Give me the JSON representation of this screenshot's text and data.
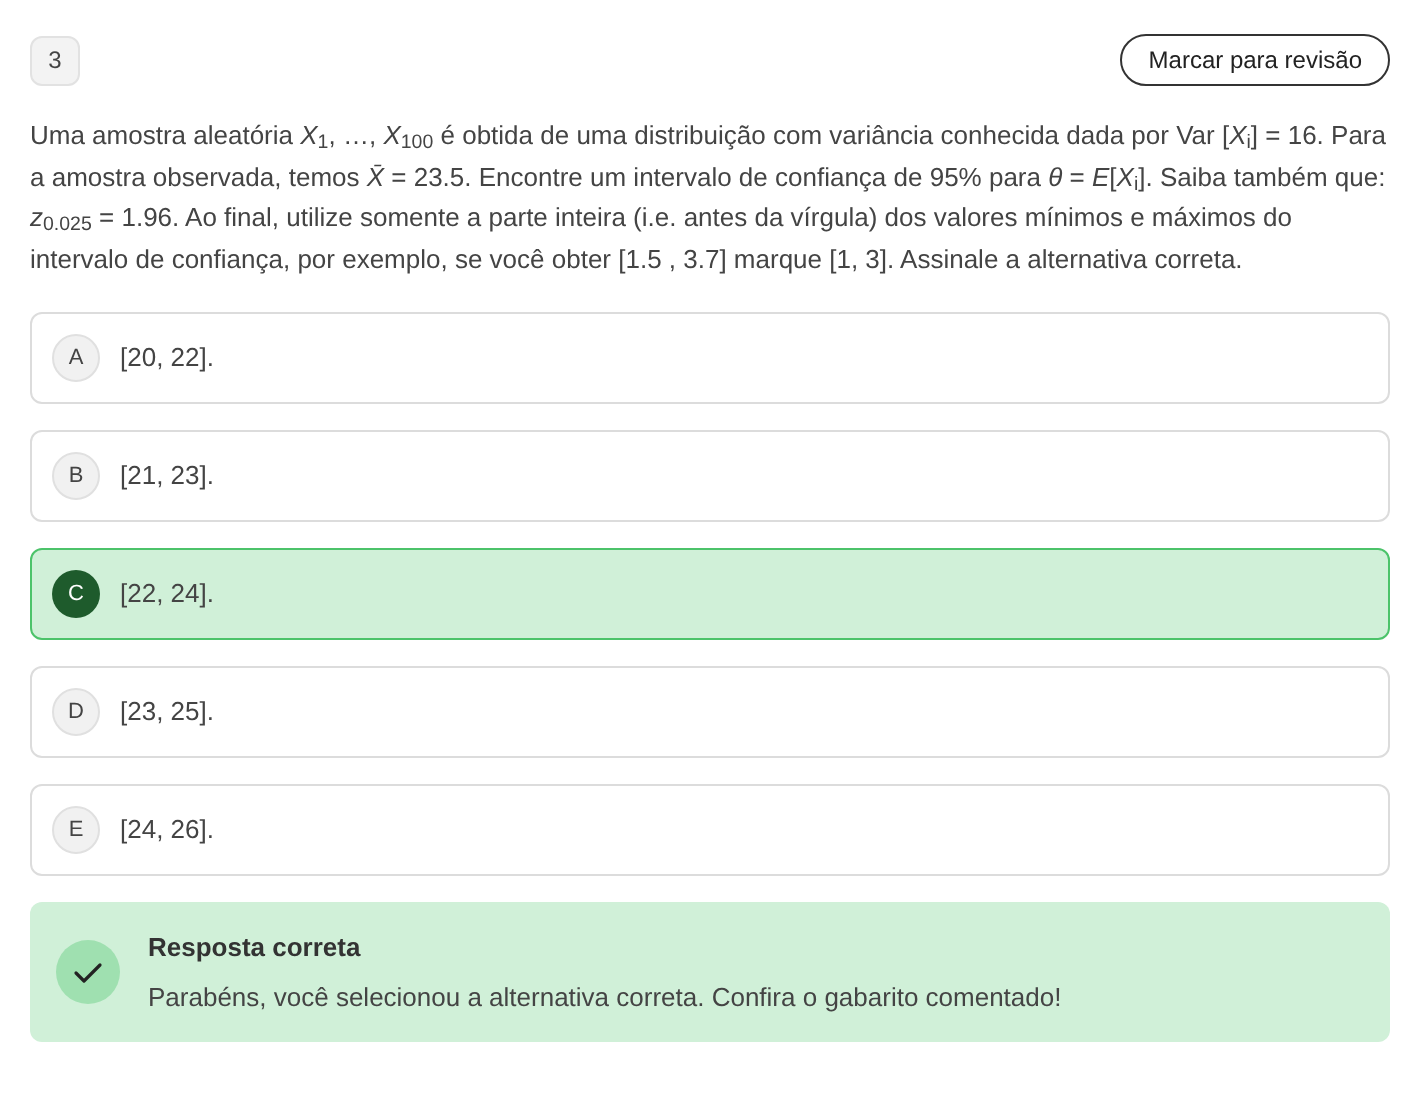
{
  "question_number": "3",
  "review_button": "Marcar para revisão",
  "question_text": "Uma amostra aleatória *X*$_{1}$, …, *X*$_{100}$ é obtida de uma distribuição com variância conhecida dada por Var [*X*$_{i}$] = 16. Para a amostra observada, temos *X̄* = 23.5. Encontre um intervalo de confiança de 95% para *θ* = *E*[*X*$_{i}$]. Saiba também que: *z*$_{0.025}$ = 1.96. Ao final, utilize somente a parte inteira (i.e. antes da vírgula) dos valores mínimos e máximos do intervalo de confiança, por exemplo, se você obter [1.5 , 3.7] marque [1, 3]. Assinale a alternativa correta.",
  "options": [
    {
      "letter": "A",
      "text": "[20, 22].",
      "selected": false
    },
    {
      "letter": "B",
      "text": "[21, 23].",
      "selected": false
    },
    {
      "letter": "C",
      "text": "[22, 24].",
      "selected": true
    },
    {
      "letter": "D",
      "text": "[23, 25].",
      "selected": false
    },
    {
      "letter": "E",
      "text": "[24, 26].",
      "selected": false
    }
  ],
  "feedback": {
    "correct": true,
    "title": "Resposta correta",
    "message": "Parabéns, você selecionou a alternativa correta. Confira o gabarito comentado!"
  }
}
